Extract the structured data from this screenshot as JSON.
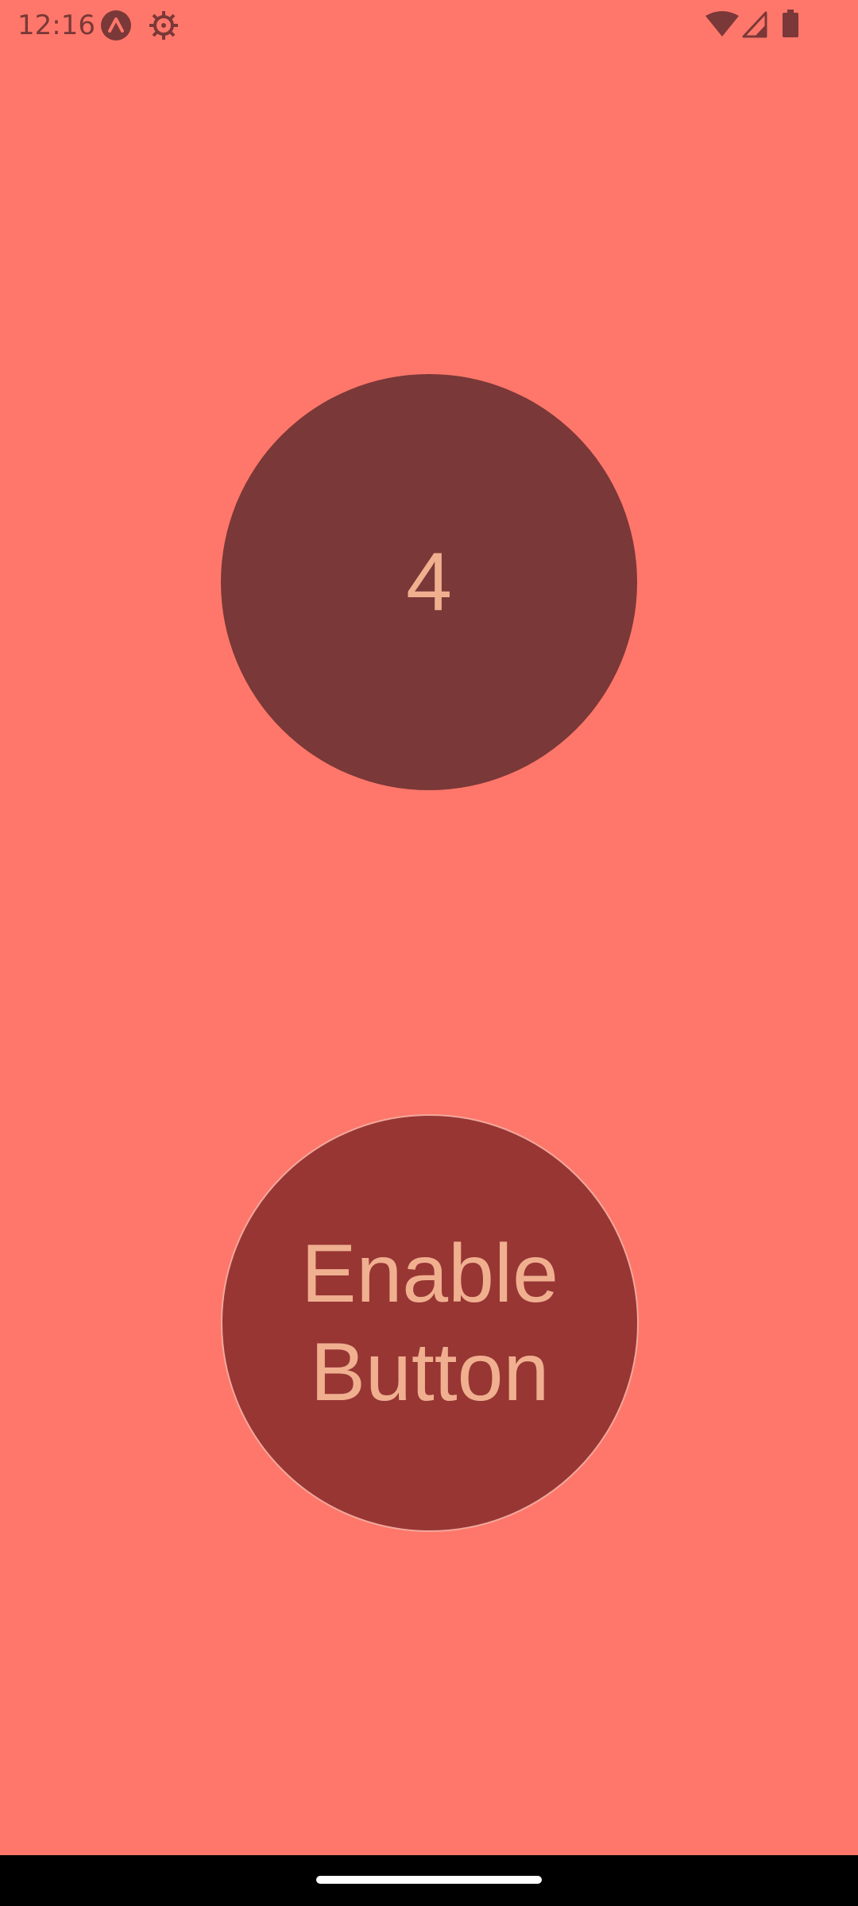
{
  "status_bar": {
    "time": "12:16",
    "icons": [
      "app-notification-icon",
      "settings-gear-icon",
      "wifi-icon",
      "cell-signal-icon",
      "battery-icon"
    ]
  },
  "counter": {
    "value": "4"
  },
  "enable_button": {
    "label": "Enable Button"
  },
  "colors": {
    "background": "#FE776A",
    "counter_circle": "#7A3838",
    "button_fill": "#983634",
    "button_border": "#F2A89C",
    "text": "#F0B090",
    "status_icons": "#7A3838"
  }
}
